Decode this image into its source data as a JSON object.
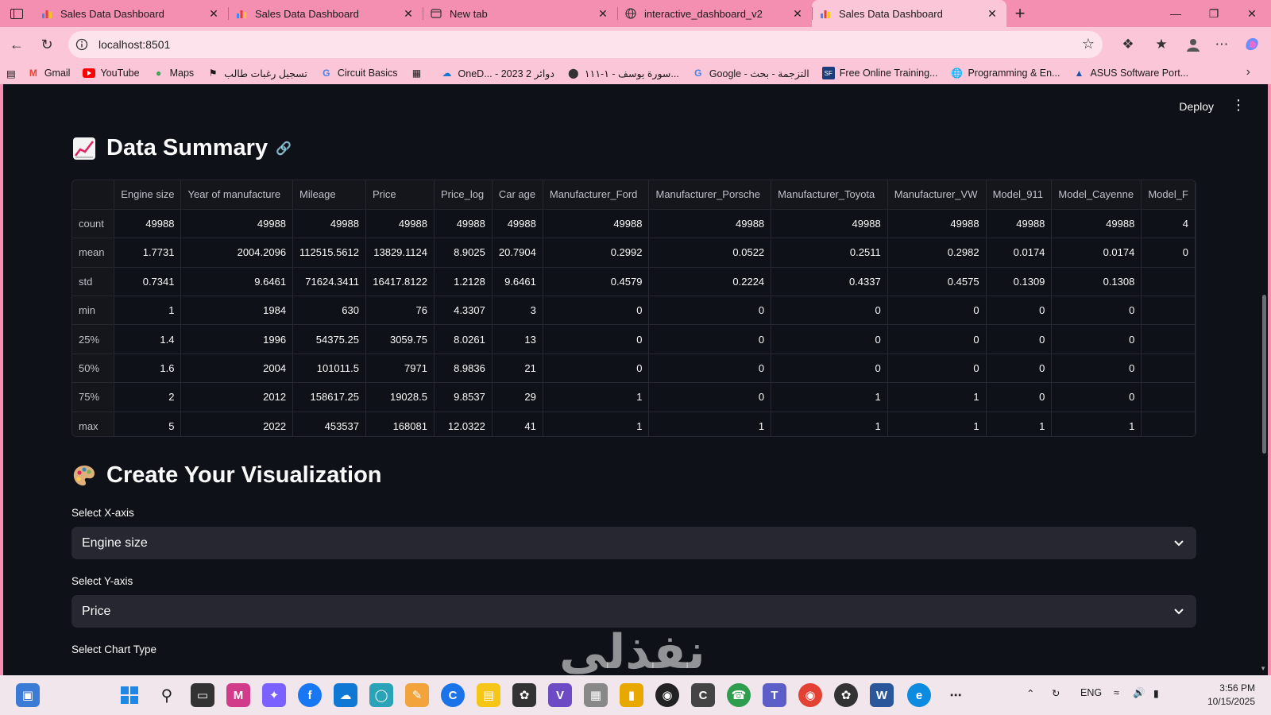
{
  "browser": {
    "tabs": [
      {
        "label": "Sales Data Dashboard",
        "active": false
      },
      {
        "label": "Sales Data Dashboard",
        "active": false
      },
      {
        "label": "New tab",
        "active": false
      },
      {
        "label": "interactive_dashboard_v2",
        "active": false
      },
      {
        "label": "Sales Data Dashboard",
        "active": true
      }
    ],
    "url": "localhost:8501",
    "bookmarks": [
      "Gmail",
      "YouTube",
      "Maps",
      "تسجيل رغبات طالب",
      "Circuit Basics",
      "",
      "OneD... - 2023 2 دوائر",
      "سورة يوسف - ١-١١١...",
      "Google - التزجمة - بحث",
      "Free Online Training...",
      "Programming & En...",
      "ASUS Software Port..."
    ]
  },
  "app": {
    "deploy_label": "Deploy",
    "summary_title": "Data Summary",
    "viz_title": "Create Your Visualization",
    "x_label": "Select X-axis",
    "x_value": "Engine size",
    "y_label": "Select Y-axis",
    "y_value": "Price",
    "chart_type_label": "Select Chart Type"
  },
  "table": {
    "columns": [
      "",
      "Engine size",
      "Year of manufacture",
      "Mileage",
      "Price",
      "Price_log",
      "Car age",
      "Manufacturer_Ford",
      "Manufacturer_Porsche",
      "Manufacturer_Toyota",
      "Manufacturer_VW",
      "Model_911",
      "Model_Cayenne",
      "Model_F"
    ],
    "rows": [
      [
        "count",
        "49988",
        "49988",
        "49988",
        "49988",
        "49988",
        "49988",
        "49988",
        "49988",
        "49988",
        "49988",
        "49988",
        "49988",
        "4"
      ],
      [
        "mean",
        "1.7731",
        "2004.2096",
        "112515.5612",
        "13829.1124",
        "8.9025",
        "20.7904",
        "0.2992",
        "0.0522",
        "0.2511",
        "0.2982",
        "0.0174",
        "0.0174",
        "0"
      ],
      [
        "std",
        "0.7341",
        "9.6461",
        "71624.3411",
        "16417.8122",
        "1.2128",
        "9.6461",
        "0.4579",
        "0.2224",
        "0.4337",
        "0.4575",
        "0.1309",
        "0.1308",
        ""
      ],
      [
        "min",
        "1",
        "1984",
        "630",
        "76",
        "4.3307",
        "3",
        "0",
        "0",
        "0",
        "0",
        "0",
        "0",
        ""
      ],
      [
        "25%",
        "1.4",
        "1996",
        "54375.25",
        "3059.75",
        "8.0261",
        "13",
        "0",
        "0",
        "0",
        "0",
        "0",
        "0",
        ""
      ],
      [
        "50%",
        "1.6",
        "2004",
        "101011.5",
        "7971",
        "8.9836",
        "21",
        "0",
        "0",
        "0",
        "0",
        "0",
        "0",
        ""
      ],
      [
        "75%",
        "2",
        "2012",
        "158617.25",
        "19028.5",
        "9.8537",
        "29",
        "1",
        "0",
        "1",
        "1",
        "0",
        "0",
        ""
      ],
      [
        "max",
        "5",
        "2022",
        "453537",
        "168081",
        "12.0322",
        "41",
        "1",
        "1",
        "1",
        "1",
        "1",
        "1",
        ""
      ]
    ]
  },
  "taskbar": {
    "lang": "ENG",
    "time": "3:56 PM",
    "date": "10/15/2025"
  },
  "watermark": "نفذلي",
  "colors": {
    "browser_frame": "#f48fb1",
    "app_bg": "#0e1117",
    "widget_bg": "#262730"
  }
}
